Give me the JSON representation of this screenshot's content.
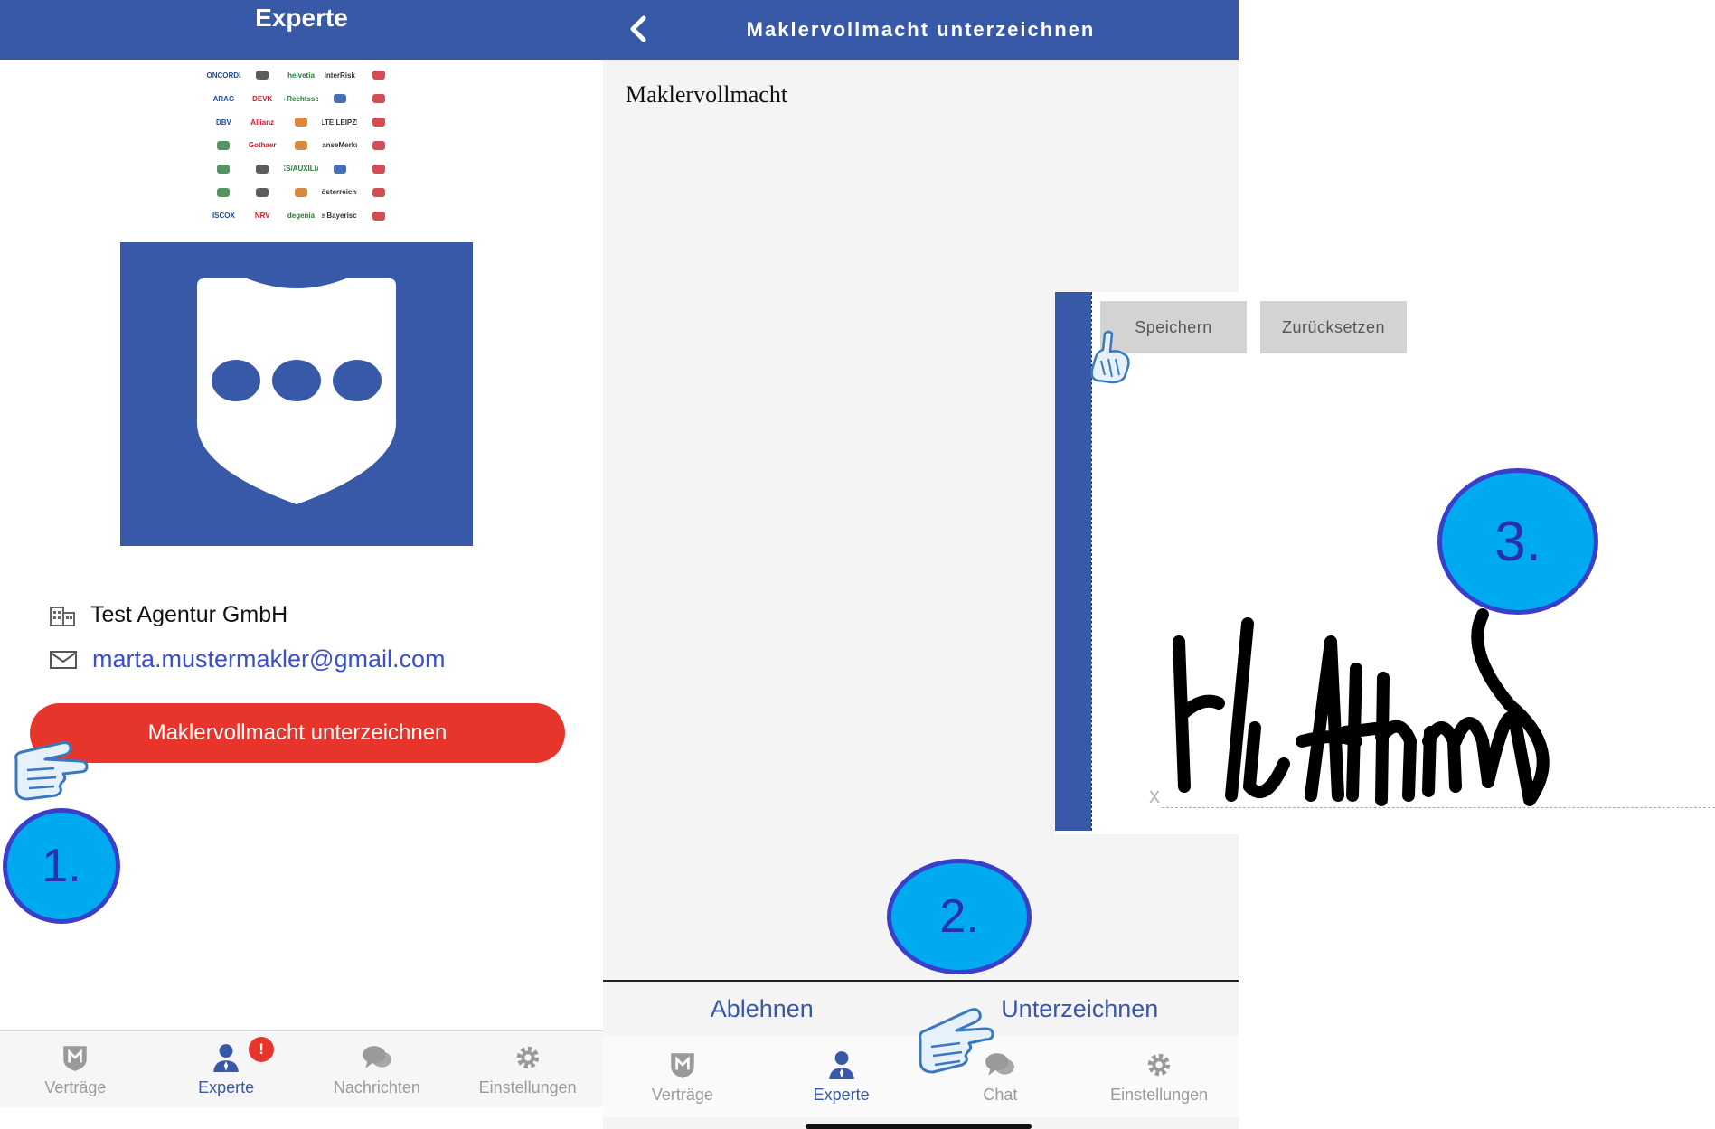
{
  "left_screen": {
    "header_title": "Experte",
    "partner_logos": [
      "CONCORDIA",
      "",
      "helvetia",
      "InterRisk",
      "",
      "ARAG",
      "DEVK",
      "DMB Rechtsschutz",
      "",
      "",
      "DBV",
      "Allianz",
      "",
      "ALTE LEIPZIG",
      "",
      "",
      "Gothaer",
      "",
      "HanseMerkur",
      "",
      "",
      "",
      "KS/AUXILIA",
      "",
      "",
      "",
      "",
      "",
      "Oberösterreichische",
      "",
      "ISCOX",
      "NRV",
      "degenia",
      "die Bayerische",
      ""
    ],
    "agency_name": "Test Agentur GmbH",
    "email": "marta.mustermakler@gmail.com",
    "sign_button": "Maklervollmacht unterzeichnen",
    "tabs": [
      {
        "label": "Verträge",
        "icon": "shield-m-icon",
        "active": false
      },
      {
        "label": "Experte",
        "icon": "person-icon",
        "active": true,
        "badge": "!"
      },
      {
        "label": "Nachrichten",
        "icon": "chat-bubbles-icon",
        "active": false
      },
      {
        "label": "Einstellungen",
        "icon": "gear-icon",
        "active": false
      }
    ]
  },
  "right_screen": {
    "header_title": "Maklervollmacht unterzeichnen",
    "document_title": "Maklervollmacht",
    "decline_label": "Ablehnen",
    "sign_label": "Unterzeichnen",
    "tabs": [
      {
        "label": "Verträge",
        "icon": "shield-m-icon",
        "active": false
      },
      {
        "label": "Experte",
        "icon": "person-icon",
        "active": true
      },
      {
        "label": "Chat",
        "icon": "chat-bubbles-icon",
        "active": false
      },
      {
        "label": "Einstellungen",
        "icon": "gear-icon",
        "active": false
      }
    ]
  },
  "signature_pad": {
    "save_label": "Speichern",
    "reset_label": "Zurücksetzen",
    "x_marker": "X"
  },
  "steps": [
    "1.",
    "2.",
    "3."
  ],
  "colors": {
    "brand_blue": "#3858a8",
    "sign_red": "#e8352b",
    "step_fill": "#00aaf0",
    "step_border": "#3a3ec8"
  }
}
